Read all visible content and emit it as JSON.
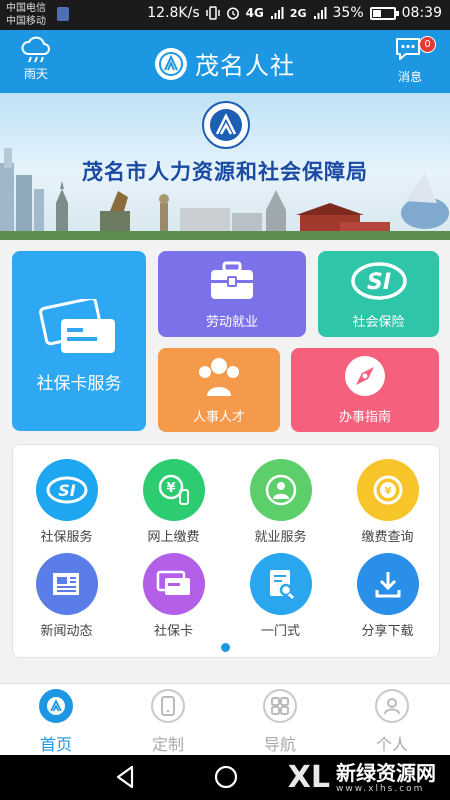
{
  "status_bar": {
    "carrier_1": "中国电信",
    "carrier_2": "中国移动",
    "net_speed": "12.8K/s",
    "net_4g": "4G",
    "net_2g": "2G",
    "battery": "35%",
    "time": "08:39"
  },
  "header": {
    "weather_label": "雨天",
    "title": "茂名人社",
    "message_label": "消息",
    "message_badge": "0"
  },
  "banner": {
    "title": "茂名市人力资源和社会保障局"
  },
  "tiles": {
    "card_service": "社保卡服务",
    "employment": "劳动就业",
    "social_insurance": "社会保险",
    "hr_talent": "人事人才",
    "guide": "办事指南"
  },
  "grid": [
    {
      "label": "社保服务",
      "icon": "si-logo-icon",
      "color": "#1da7f0"
    },
    {
      "label": "网上缴费",
      "icon": "yuan-icon",
      "color": "#2ecc71"
    },
    {
      "label": "就业服务",
      "icon": "person-icon",
      "color": "#5ccf6b"
    },
    {
      "label": "缴费查询",
      "icon": "coin-search-icon",
      "color": "#f7c52a"
    },
    {
      "label": "新闻动态",
      "icon": "news-icon",
      "color": "#5b7de8"
    },
    {
      "label": "社保卡",
      "icon": "card-icon",
      "color": "#b45fe8"
    },
    {
      "label": "一门式",
      "icon": "document-search-icon",
      "color": "#2aa6ee"
    },
    {
      "label": "分享下载",
      "icon": "download-icon",
      "color": "#2a8fe8"
    }
  ],
  "bottom_nav": [
    {
      "label": "首页",
      "active": true
    },
    {
      "label": "定制",
      "active": false
    },
    {
      "label": "导航",
      "active": false
    },
    {
      "label": "个人",
      "active": false
    }
  ],
  "watermark": {
    "logo": "XL",
    "text_cn": "新绿资源网",
    "text_en": "www.xlhs.com"
  }
}
